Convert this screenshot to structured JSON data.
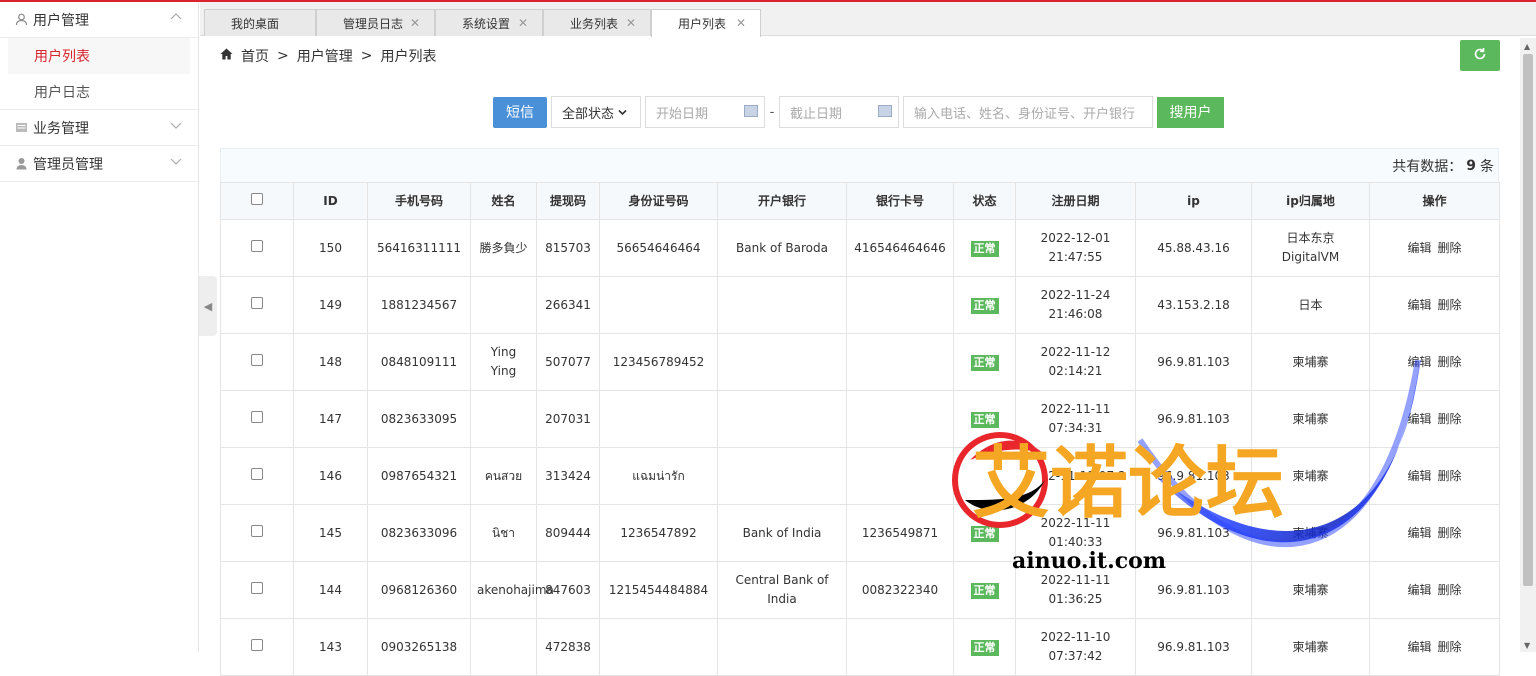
{
  "sidebar": {
    "groups": [
      {
        "label": "用户管理",
        "icon": "user-icon",
        "open": true,
        "items": [
          {
            "label": "用户列表",
            "active": true
          },
          {
            "label": "用户日志",
            "active": false
          }
        ]
      },
      {
        "label": "业务管理",
        "icon": "list-icon",
        "open": false
      },
      {
        "label": "管理员管理",
        "icon": "person-icon",
        "open": false
      }
    ]
  },
  "tabs": [
    {
      "label": "我的桌面",
      "closable": false
    },
    {
      "label": "管理员日志",
      "closable": true
    },
    {
      "label": "系统设置",
      "closable": true
    },
    {
      "label": "业务列表",
      "closable": true
    },
    {
      "label": "用户列表",
      "closable": true,
      "active": true
    }
  ],
  "breadcrumb": [
    "首页",
    ">",
    "用户管理",
    ">",
    "用户列表"
  ],
  "search": {
    "sms_label": "短信",
    "status_select": "全部状态",
    "start_placeholder": "开始日期",
    "end_placeholder": "截止日期",
    "dash": "-",
    "keyword_placeholder": "输入电话、姓名、身份证号、开户银行",
    "search_label": "搜用户"
  },
  "count": {
    "prefix": "共有数据：",
    "value": "9",
    "suffix": "条"
  },
  "table": {
    "headers": [
      "",
      "ID",
      "手机号码",
      "姓名",
      "提现码",
      "身份证号码",
      "开户银行",
      "银行卡号",
      "状态",
      "注册日期",
      "ip",
      "ip归属地",
      "操作"
    ],
    "edit_label": "编辑",
    "delete_label": "删除",
    "rows": [
      {
        "id": "150",
        "phone": "56416311111",
        "name": "勝多負少",
        "code": "815703",
        "idcard": "56654646464",
        "bank": "Bank of Baroda",
        "card": "416546464646",
        "status": "正常",
        "date": "2022-12-01 21:47:55",
        "ip": "45.88.43.16",
        "geo": "日本东京DigitalVM"
      },
      {
        "id": "149",
        "phone": "1881234567",
        "name": "",
        "code": "266341",
        "idcard": "",
        "bank": "",
        "card": "",
        "status": "正常",
        "date": "2022-11-24 21:46:08",
        "ip": "43.153.2.18",
        "geo": "日本"
      },
      {
        "id": "148",
        "phone": "0848109111",
        "name": "Ying Ying",
        "code": "507077",
        "idcard": "123456789452",
        "bank": "",
        "card": "",
        "status": "正常",
        "date": "2022-11-12 02:14:21",
        "ip": "96.9.81.103",
        "geo": "柬埔寨"
      },
      {
        "id": "147",
        "phone": "0823633095",
        "name": "",
        "code": "207031",
        "idcard": "",
        "bank": "",
        "card": "",
        "status": "正常",
        "date": "2022-11-11 07:34:31",
        "ip": "96.9.81.103",
        "geo": "柬埔寨"
      },
      {
        "id": "146",
        "phone": "0987654321",
        "name": "คนสวย",
        "code": "313424",
        "idcard": "แฉมน่ารัก",
        "bank": "",
        "card": "",
        "status": "正常",
        "date": "2022-11-11 07:2",
        "ip": "96.9.81.103",
        "geo": "柬埔寨"
      },
      {
        "id": "145",
        "phone": "0823633096",
        "name": "นิชา",
        "code": "809444",
        "idcard": "1236547892",
        "bank": "Bank of India",
        "card": "1236549871",
        "status": "正常",
        "date": "2022-11-11 01:40:33",
        "ip": "96.9.81.103",
        "geo": "柬埔寨"
      },
      {
        "id": "144",
        "phone": "0968126360",
        "name": "akenohajima",
        "code": "847603",
        "idcard": "1215454484884",
        "bank": "Central Bank of India",
        "card": "0082322340",
        "status": "正常",
        "date": "2022-11-11 01:36:25",
        "ip": "96.9.81.103",
        "geo": "柬埔寨"
      },
      {
        "id": "143",
        "phone": "0903265138",
        "name": "",
        "code": "472838",
        "idcard": "",
        "bank": "",
        "card": "",
        "status": "正常",
        "date": "2022-11-10 07:37:42",
        "ip": "96.9.81.103",
        "geo": "柬埔寨"
      }
    ]
  },
  "watermark": {
    "text": "艾诺论坛",
    "url": "ainuo.it.com"
  },
  "colors": {
    "accent": "#d9232e",
    "primary": "#4a90d9",
    "success": "#5cb85c"
  }
}
